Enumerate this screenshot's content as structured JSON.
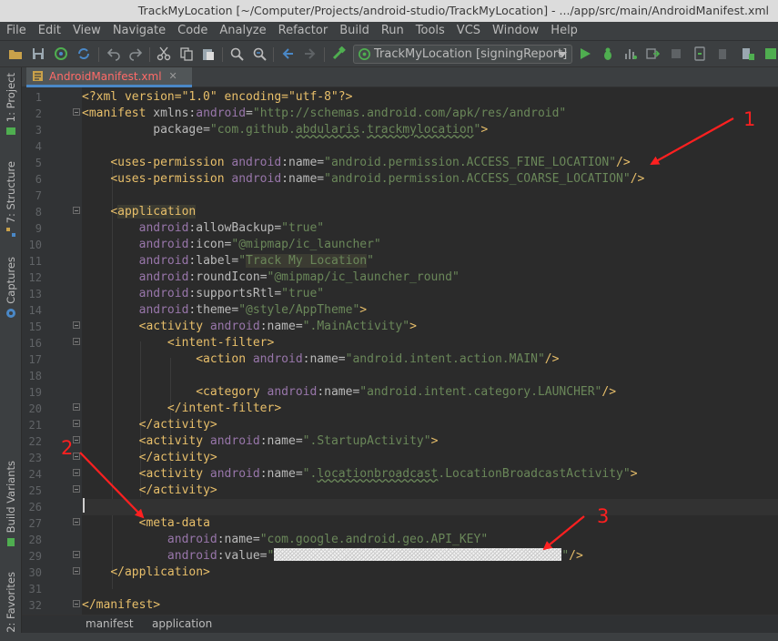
{
  "window": {
    "title": "TrackMyLocation [~/Computer/Projects/android-studio/TrackMyLocation] - .../app/src/main/AndroidManifest.xml"
  },
  "menu": [
    "File",
    "Edit",
    "View",
    "Navigate",
    "Code",
    "Analyze",
    "Refactor",
    "Build",
    "Run",
    "Tools",
    "VCS",
    "Window",
    "Help"
  ],
  "toolbar": {
    "run_config": "TrackMyLocation [signingReport]",
    "icons": [
      "open-icon",
      "save-icon",
      "sync-icon",
      "refresh-icon",
      "undo-icon",
      "redo-icon",
      "cut-icon",
      "copy-icon",
      "paste-icon",
      "find-icon",
      "replace-icon",
      "back-icon",
      "forward-icon",
      "build-icon",
      "run-icon",
      "debug-icon",
      "profile-icon",
      "attach-icon",
      "stop-icon",
      "sdk-manager-icon"
    ]
  },
  "left_tabs": [
    {
      "label": "1: Project",
      "icon": "project-icon"
    },
    {
      "label": "7: Structure",
      "icon": "structure-icon"
    },
    {
      "label": "Captures",
      "icon": "captures-icon"
    },
    {
      "label": "Build Variants",
      "icon": "build-variants-icon"
    },
    {
      "label": "2: Favorites",
      "icon": "favorites-icon"
    }
  ],
  "editor": {
    "file_tab": "AndroidManifest.xml",
    "line_numbers": [
      "1",
      "2",
      "3",
      "4",
      "5",
      "6",
      "7",
      "8",
      "9",
      "10",
      "11",
      "12",
      "13",
      "14",
      "15",
      "16",
      "17",
      "18",
      "19",
      "20",
      "21",
      "22",
      "23",
      "24",
      "25",
      "26",
      "27",
      "28",
      "29",
      "30",
      "31",
      "32"
    ],
    "code": {
      "l1_decl": "<?xml version=\"1.0\" encoding=\"utf-8\"?>",
      "l2_tag": "<manifest",
      "l2_xmlns": "xmlns:",
      "l2_ns": "android",
      "l2_eq": "=",
      "l2_val": "\"http://schemas.android.com/apk/res/android\"",
      "l3_attr": "package=",
      "l3_q1": "\"com.github.",
      "l3_typo": "abdularis",
      "l3_dot": ".",
      "l3_typo2": "trackmylocation",
      "l3_q2": "\"",
      "l3_close": ">",
      "l5_tag": "<uses-permission",
      "l5_ns": "android",
      "l5_attr": ":name=",
      "l5_val": "\"android.permission.ACCESS_FINE_LOCATION\"",
      "l5_close": "/>",
      "l6_tag": "<uses-permission",
      "l6_ns": "android",
      "l6_attr": ":name=",
      "l6_val": "\"android.permission.ACCESS_COARSE_LOCATION\"",
      "l6_close": "/>",
      "l8_lt": "<",
      "l8_tag": "application",
      "l9_ns": "android",
      "l9_attr": ":allowBackup=",
      "l9_val": "\"true\"",
      "l10_ns": "android",
      "l10_attr": ":icon=",
      "l10_val": "\"@mipmap/ic_launcher\"",
      "l11_ns": "android",
      "l11_attr": ":label=",
      "l11_q1": "\"",
      "l11_val": "Track My Location",
      "l11_q2": "\"",
      "l12_ns": "android",
      "l12_attr": ":roundIcon=",
      "l12_val": "\"@mipmap/ic_launcher_round\"",
      "l13_ns": "android",
      "l13_attr": ":supportsRtl=",
      "l13_val": "\"true\"",
      "l14_ns": "android",
      "l14_attr": ":theme=",
      "l14_val": "\"@style/AppTheme\"",
      "l15_tag": "<activity",
      "l15_ns": "android",
      "l15_attr": ":name=",
      "l15_val": "\".MainActivity\"",
      "l15_close": ">",
      "l16_tag": "<intent-filter>",
      "l17_tag": "<action",
      "l17_ns": "android",
      "l17_attr": ":name=",
      "l17_val": "\"android.intent.action.MAIN\"",
      "l17_close": "/>",
      "l19_tag": "<category",
      "l19_ns": "android",
      "l19_attr": ":name=",
      "l19_val": "\"android.intent.category.LAUNCHER\"",
      "l19_close": "/>",
      "l20_tag": "</intent-filter>",
      "l21_tag": "</activity>",
      "l22_tag": "<activity",
      "l22_ns": "android",
      "l22_attr": ":name=",
      "l22_val": "\".StartupActivity\"",
      "l22_close": ">",
      "l23_tag": "</activity>",
      "l24_tag": "<activity",
      "l24_ns": "android",
      "l24_attr": ":name=",
      "l24_q1": "\".",
      "l24_typo": "locationbroadcast",
      "l24_val2": ".LocationBroadcastActivity\"",
      "l24_close": ">",
      "l25_tag": "</activity>",
      "l27_tag": "<meta-data",
      "l28_ns": "android",
      "l28_attr": ":name=",
      "l28_val": "\"com.google.android.geo.API_KEY\"",
      "l29_ns": "android",
      "l29_attr": ":value=",
      "l29_q1": "\"",
      "l29_q2": "\"",
      "l29_close": "/>",
      "l30_tag": "</application>",
      "l32_tag": "</manifest>"
    }
  },
  "breadcrumb": [
    "manifest",
    "application"
  ],
  "annotations": [
    "1",
    "2",
    "3"
  ],
  "colors": {
    "annotation": "#ff2020",
    "tab_text": "#ff6b68",
    "tag": "#e8bf6a",
    "namespace": "#9876aa",
    "value": "#6a8759"
  }
}
